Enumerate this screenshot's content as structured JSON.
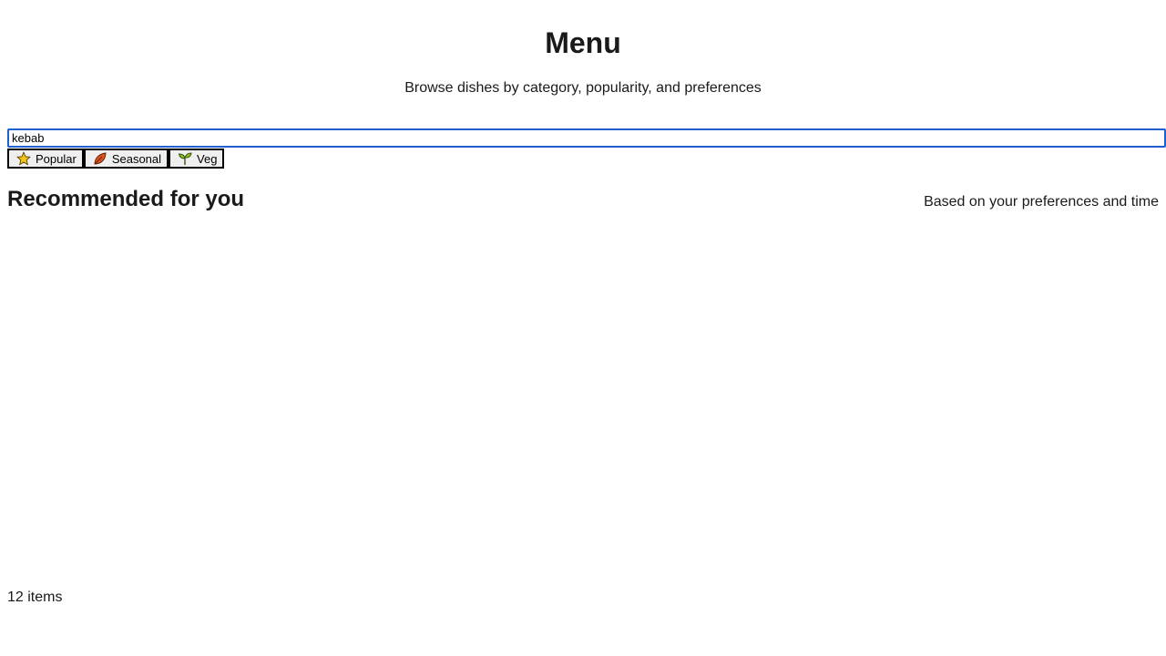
{
  "header": {
    "title": "Menu",
    "subtitle": "Browse dishes by category, popularity, and preferences"
  },
  "search": {
    "value": "kebab"
  },
  "filters": [
    {
      "label": "Popular",
      "icon": "star-icon"
    },
    {
      "label": "Seasonal",
      "icon": "leaf-icon"
    },
    {
      "label": "Veg",
      "icon": "sprout-icon"
    }
  ],
  "recommended": {
    "title": "Recommended for you",
    "note": "Based on your preferences and time"
  },
  "footer": {
    "count": "12 items"
  },
  "colors": {
    "focus_ring": "#1f5fcf",
    "star_fill": "#f5c518",
    "leaf_fill": "#e0521b",
    "sprout_fill": "#8fc31f"
  }
}
